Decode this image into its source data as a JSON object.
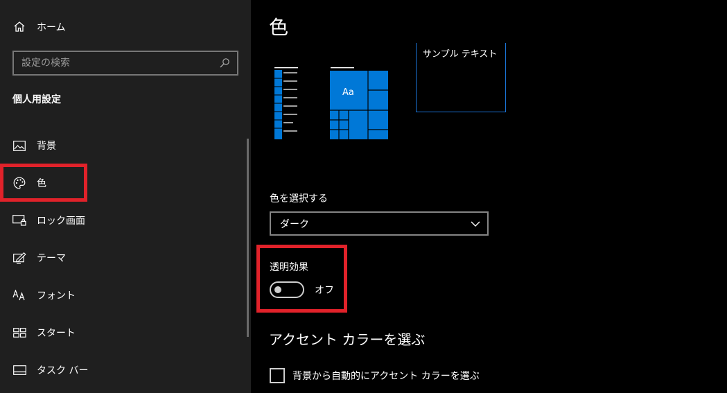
{
  "sidebar": {
    "home_label": "ホーム",
    "search_placeholder": "設定の検索",
    "section_title": "個人用設定",
    "items": [
      {
        "label": "背景",
        "icon": "picture-icon"
      },
      {
        "label": "色",
        "icon": "palette-icon"
      },
      {
        "label": "ロック画面",
        "icon": "lock-screen-icon"
      },
      {
        "label": "テーマ",
        "icon": "theme-icon"
      },
      {
        "label": "フォント",
        "icon": "font-icon"
      },
      {
        "label": "スタート",
        "icon": "start-icon"
      },
      {
        "label": "タスク バー",
        "icon": "taskbar-icon"
      }
    ]
  },
  "main": {
    "title": "色",
    "preview": {
      "tile_text": "Aa",
      "sample_text": "サンプル テキスト"
    },
    "mode": {
      "label": "色を選択する",
      "value": "ダーク"
    },
    "transparency": {
      "label": "透明効果",
      "state": "オフ"
    },
    "accent": {
      "title": "アクセント カラーを選ぶ",
      "auto_checkbox_label": "背景から自動的にアクセント カラーを選ぶ"
    }
  },
  "colors": {
    "accent": "#0078d7",
    "highlight": "#e1222a"
  }
}
